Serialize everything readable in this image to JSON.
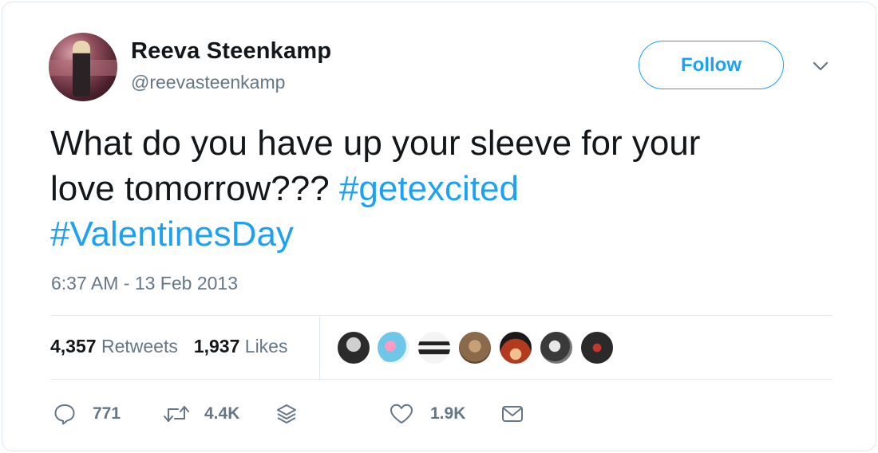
{
  "user": {
    "name": "Reeva Steenkamp",
    "handle": "@reevasteenkamp",
    "follow_label": "Follow"
  },
  "tweet": {
    "text_lines": [
      "What do you have up your sleeve for your",
      "love tomorrow??? "
    ],
    "hashtags": [
      "#getexcited",
      "#ValentinesDay"
    ],
    "timestamp": "6:37 AM - 13 Feb 2013"
  },
  "stats": {
    "retweets_count": "4,357",
    "retweets_label": "Retweets",
    "likes_count": "1,937",
    "likes_label": "Likes"
  },
  "liker_avatars": [
    {
      "icon": "liker-avatar-1",
      "color": "#2b2b2b"
    },
    {
      "icon": "liker-avatar-2",
      "color": "#6ec6e8"
    },
    {
      "icon": "liker-avatar-3",
      "color": "#f2f2f2"
    },
    {
      "icon": "liker-avatar-4",
      "color": "#8a6a4a"
    },
    {
      "icon": "liker-avatar-5",
      "color": "#b23a1e"
    },
    {
      "icon": "liker-avatar-6",
      "color": "#3a3a3a"
    },
    {
      "icon": "liker-avatar-7",
      "color": "#2a2a2a"
    }
  ],
  "actions": {
    "reply_count": "771",
    "retweet_count": "4.4K",
    "like_count": "1.9K"
  },
  "colors": {
    "accent": "#1da1f2",
    "text": "#14171a",
    "muted": "#657786",
    "border": "#e1e8ed"
  }
}
